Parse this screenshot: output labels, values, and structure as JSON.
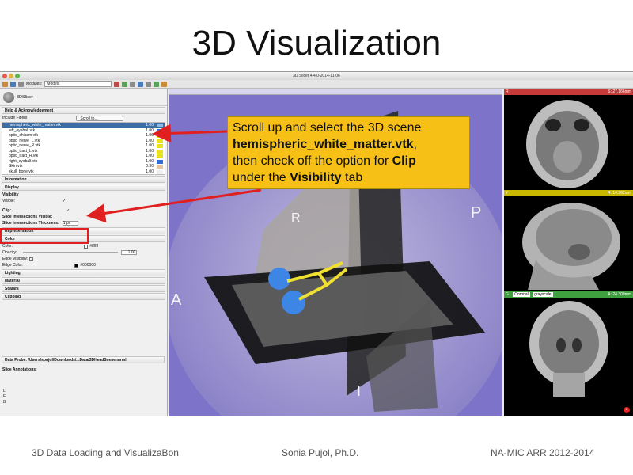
{
  "slide": {
    "title": "3D Visualization",
    "footer_left": "3D Data Loading and VisualizaBon",
    "footer_center": "Sonia Pujol, Ph.D.",
    "footer_right": "NA-MIC ARR 2012-2014"
  },
  "window": {
    "title": "3D Slicer 4.4.0-2014-11-06"
  },
  "toolbar": {
    "modules_label": "Modules:",
    "module_selected": "Models"
  },
  "panel": {
    "logo_text": "3DSlicer",
    "help_section": "Help & Acknowledgement",
    "include_fibers_label": "Include Fibers",
    "scroll_to_label": "Scroll to...",
    "models": [
      {
        "name": "hemispheric_white_matter.vtk",
        "value": "1.00",
        "color": "#8fb8e6",
        "selected": true
      },
      {
        "name": "left_eyeball.vtk",
        "value": "1.00",
        "color": "#2d6fd6"
      },
      {
        "name": "optic_chiasm.vtk",
        "value": "1.00",
        "color": "#e8e020"
      },
      {
        "name": "optic_nerve_L.vtk",
        "value": "1.00",
        "color": "#e8e020"
      },
      {
        "name": "optic_nerve_R.vtk",
        "value": "1.00",
        "color": "#e8e020"
      },
      {
        "name": "optic_tract_L.vtk",
        "value": "1.00",
        "color": "#e8e020"
      },
      {
        "name": "optic_tract_R.vtk",
        "value": "1.00",
        "color": "#e8e020"
      },
      {
        "name": "right_eyeball.vtk",
        "value": "1.00",
        "color": "#2d6fd6"
      },
      {
        "name": "Skin.vtk",
        "value": "0.30",
        "color": "#e9c4a0"
      },
      {
        "name": "skull_bone.vtk",
        "value": "1.00",
        "color": "#eeeeee"
      }
    ],
    "information_section": "Information",
    "display_section": "Display",
    "visibility_tab": "Visibility",
    "visible_label": "Visible:",
    "clip_label": "Clip:",
    "slice_intersections_visible_label": "Slice Intersections Visible:",
    "slice_intersections_thickness_label": "Slice Intersections Thickness:",
    "slice_thickness_value": "1 px",
    "representation_section": "Representation",
    "color_section": "Color",
    "color_label": "Color:",
    "color_value": "#ffffff",
    "opacity_label": "Opacity:",
    "opacity_value": "1.00",
    "edge_visibility_label": "Edge Visibility:",
    "edge_color_label": "Edge Color:",
    "edge_color_value": "#000000",
    "lighting_section": "Lighting",
    "material_section": "Material",
    "scalars_section": "Scalars",
    "clipping_section": "Clipping",
    "data_probe_label": "Data Probe: /Users/spujol/Downloads/...Data/3DHeadScene.mrml",
    "slice_annotations_label": "Slice Annotations:",
    "probe_letters": [
      "L",
      "F",
      "B"
    ]
  },
  "view3d": {
    "labels": {
      "R": "R",
      "P": "P",
      "A": "A",
      "I": "I"
    }
  },
  "callout": {
    "line1": "Scroll up and select the 3D scene",
    "filename": "hemispheric_white_matter.vtk",
    "after_filename": ",",
    "line3_pre": "then check off the option for ",
    "clip": "Clip",
    "line4_pre": "under the ",
    "visibility": "Visibility",
    "line4_post": " tab"
  },
  "slice_views": [
    {
      "letter": "R",
      "readout": "S: 27.166mm",
      "color": "#c63a3a"
    },
    {
      "letter": "Y",
      "readout": "R: 14.962mm",
      "color": "#c8b800"
    },
    {
      "letter": "G",
      "readout": "A: 24.309mm",
      "orientation": "Coronal",
      "volume": "grayscale",
      "color": "#3fa03f"
    }
  ],
  "colors": {
    "view3d_bg": "#7d73c8",
    "callout_bg": "#f6c016",
    "highlight_red": "#e02020",
    "selection_blue": "#3a6ea5"
  }
}
